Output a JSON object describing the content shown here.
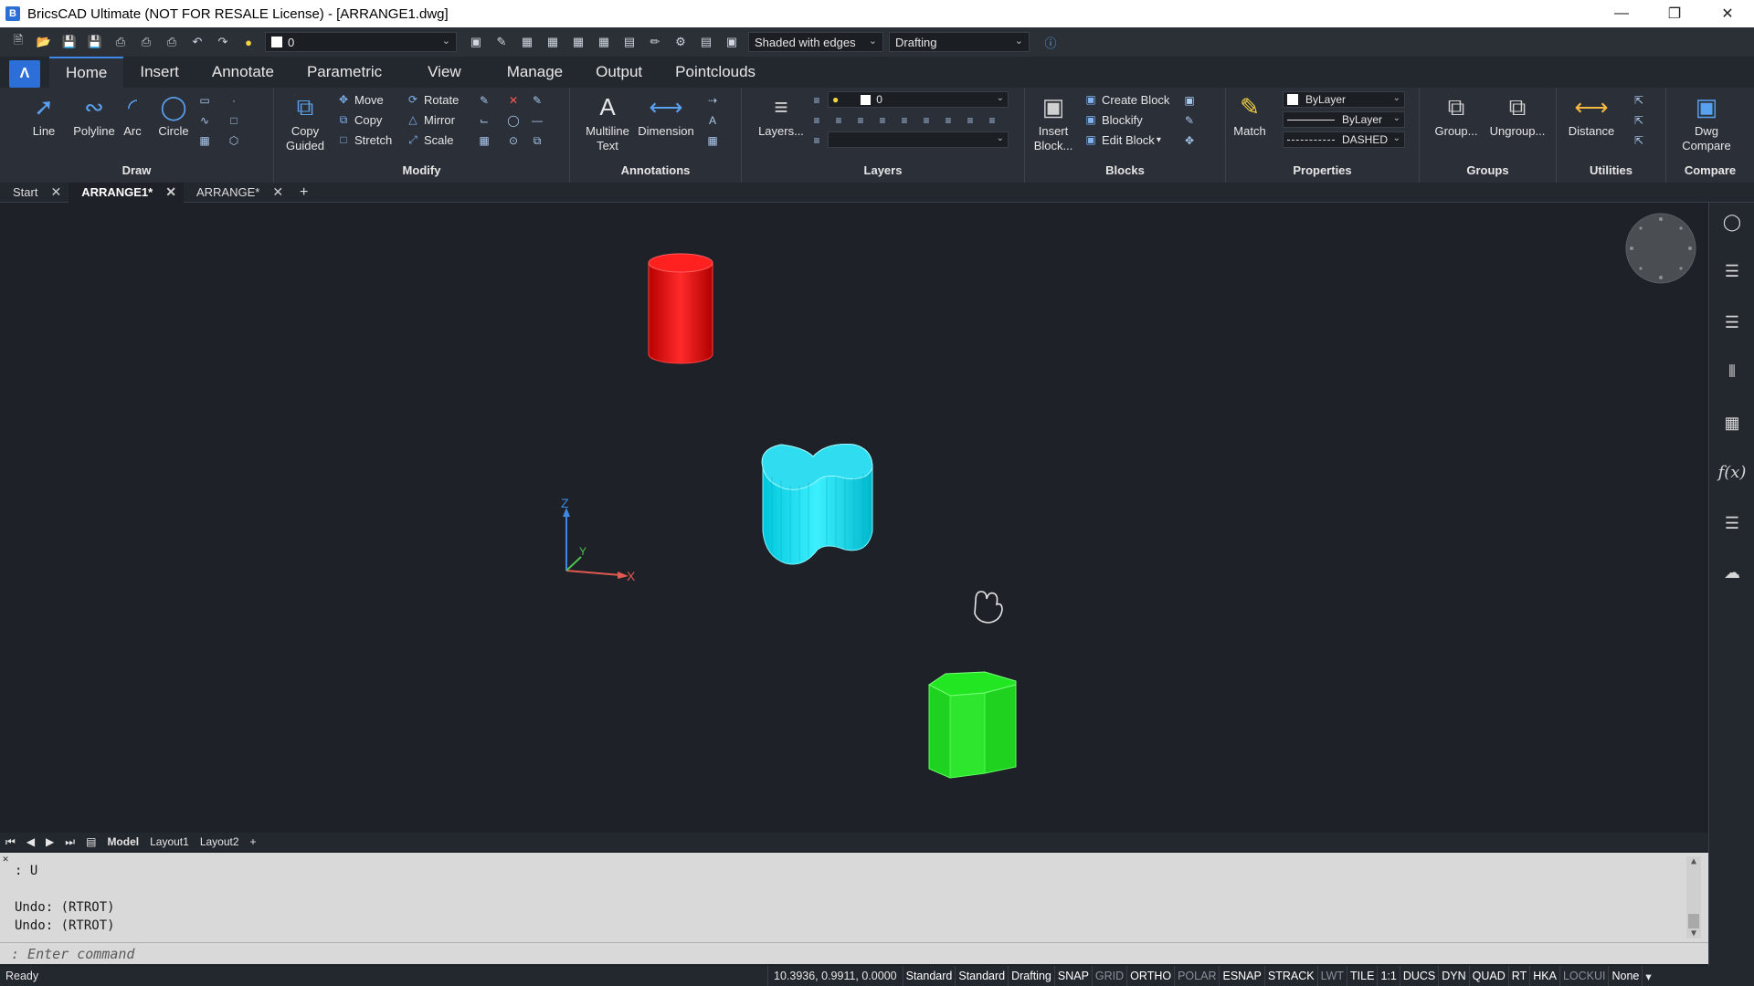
{
  "window": {
    "title": "BricsCAD Ultimate (NOT FOR RESALE License) - [ARRANGE1.dwg]",
    "app_logo": "B"
  },
  "quick_access": {
    "layer_value": "0",
    "visual_style": "Shaded with edges",
    "workspace": "Drafting"
  },
  "ribbon_tabs": [
    {
      "label": "Home",
      "active": true
    },
    {
      "label": "Insert"
    },
    {
      "label": "Annotate"
    },
    {
      "label": "Parametric"
    },
    {
      "label": "View"
    },
    {
      "label": "Manage"
    },
    {
      "label": "Output"
    },
    {
      "label": "Pointclouds"
    }
  ],
  "ribbon": {
    "draw": {
      "title": "Draw",
      "line": "Line",
      "polyline": "Polyline",
      "arc": "Arc",
      "circle": "Circle"
    },
    "modify": {
      "title": "Modify",
      "copy_guided": "Copy Guided",
      "move": "Move",
      "copy": "Copy",
      "stretch": "Stretch",
      "rotate": "Rotate",
      "mirror": "Mirror",
      "scale": "Scale"
    },
    "annotations": {
      "title": "Annotations",
      "multiline_text": "Multiline Text",
      "dimension": "Dimension"
    },
    "layers": {
      "title": "Layers",
      "layers_btn": "Layers...",
      "layer_value": "0"
    },
    "blocks": {
      "title": "Blocks",
      "insert_block": "Insert Block...",
      "create_block": "Create Block",
      "blockify": "Blockify",
      "edit_block": "Edit Block"
    },
    "properties": {
      "title": "Properties",
      "match": "Match",
      "color": "ByLayer",
      "linetype": "ByLayer",
      "lineweight": "DASHED"
    },
    "groups": {
      "title": "Groups",
      "group": "Group...",
      "ungroup": "Ungroup..."
    },
    "utilities": {
      "title": "Utilities",
      "distance": "Distance"
    },
    "compare": {
      "title": "Compare",
      "dwg_compare": "Dwg Compare"
    }
  },
  "doc_tabs": [
    {
      "label": "Start"
    },
    {
      "label": "ARRANGE1*",
      "active": true
    },
    {
      "label": "ARRANGE*"
    }
  ],
  "ucs": {
    "x": "X",
    "y": "Y",
    "z": "Z"
  },
  "shapes": {
    "red": "#ff1a1a",
    "cyan": "#19e0f0",
    "green": "#22e622"
  },
  "layout_tabs": {
    "model": "Model",
    "layout1": "Layout1",
    "layout2": "Layout2"
  },
  "command": {
    "lines": [
      ": U",
      "",
      "Undo: (RTROT)",
      "Undo: (RTROT)"
    ],
    "prompt": ": Enter command"
  },
  "status": {
    "ready": "Ready",
    "coords": "10.3936, 0.9911, 0.0000",
    "items": [
      {
        "label": "Standard",
        "on": true
      },
      {
        "label": "Standard",
        "on": true
      },
      {
        "label": "Drafting",
        "on": true
      },
      {
        "label": "SNAP",
        "on": true
      },
      {
        "label": "GRID",
        "on": false
      },
      {
        "label": "ORTHO",
        "on": true
      },
      {
        "label": "POLAR",
        "on": false
      },
      {
        "label": "ESNAP",
        "on": true
      },
      {
        "label": "STRACK",
        "on": true
      },
      {
        "label": "LWT",
        "on": false
      },
      {
        "label": "TILE",
        "on": true
      },
      {
        "label": "1:1",
        "on": true
      },
      {
        "label": "DUCS",
        "on": true
      },
      {
        "label": "DYN",
        "on": true
      },
      {
        "label": "QUAD",
        "on": true
      },
      {
        "label": "RT",
        "on": true
      },
      {
        "label": "HKA",
        "on": true
      },
      {
        "label": "LOCKUI",
        "on": false
      },
      {
        "label": "None",
        "on": true
      }
    ]
  }
}
